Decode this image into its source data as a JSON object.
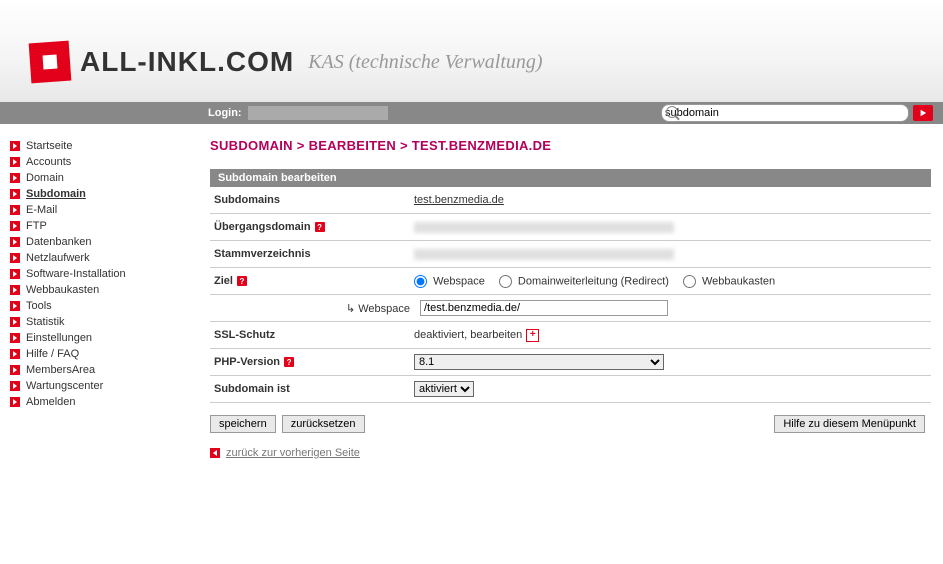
{
  "header": {
    "logo_text": "ALL-INKL.COM",
    "subtitle": "KAS (technische Verwaltung)"
  },
  "loginbar": {
    "label": "Login:",
    "search_value": "subdomain"
  },
  "sidebar": [
    {
      "label": "Startseite",
      "bold": false
    },
    {
      "label": "Accounts",
      "bold": false
    },
    {
      "label": "Domain",
      "bold": false
    },
    {
      "label": "Subdomain",
      "bold": true,
      "underline": true
    },
    {
      "label": "E-Mail",
      "bold": false
    },
    {
      "label": "FTP",
      "bold": false
    },
    {
      "label": "Datenbanken",
      "bold": false
    },
    {
      "label": "Netzlaufwerk",
      "bold": false
    },
    {
      "label": "Software-Installation",
      "bold": false
    },
    {
      "label": "Webbaukasten",
      "bold": false
    },
    {
      "label": "Tools",
      "bold": false
    },
    {
      "label": "Statistik",
      "bold": false
    },
    {
      "label": "Einstellungen",
      "bold": false
    },
    {
      "label": "Hilfe / FAQ",
      "bold": false
    },
    {
      "label": "MembersArea",
      "bold": false
    },
    {
      "label": "Wartungscenter",
      "bold": false
    },
    {
      "label": "Abmelden",
      "bold": false
    }
  ],
  "breadcrumb": "SUBDOMAIN > BEARBEITEN > TEST.BENZMEDIA.DE",
  "panel": {
    "title": "Subdomain bearbeiten",
    "subdomains_label": "Subdomains",
    "subdomains_value": "test.benzmedia.de",
    "ubergang_label": "Übergangsdomain",
    "stamm_label": "Stammverzeichnis",
    "ziel_label": "Ziel",
    "ziel_options": {
      "webspace": "Webspace",
      "redirect": "Domainweiterleitung (Redirect)",
      "webbaukasten": "Webbaukasten"
    },
    "webspace_sub_label": "↳ Webspace",
    "webspace_value": "/test.benzmedia.de/",
    "ssl_label": "SSL-Schutz",
    "ssl_value": "deaktiviert, bearbeiten",
    "php_label": "PHP-Version",
    "php_value": "8.1",
    "subist_label": "Subdomain ist",
    "subist_value": "aktiviert"
  },
  "buttons": {
    "save": "speichern",
    "reset": "zurücksetzen",
    "help": "Hilfe zu diesem Menüpunkt"
  },
  "back_link": "zurück zur vorherigen Seite"
}
